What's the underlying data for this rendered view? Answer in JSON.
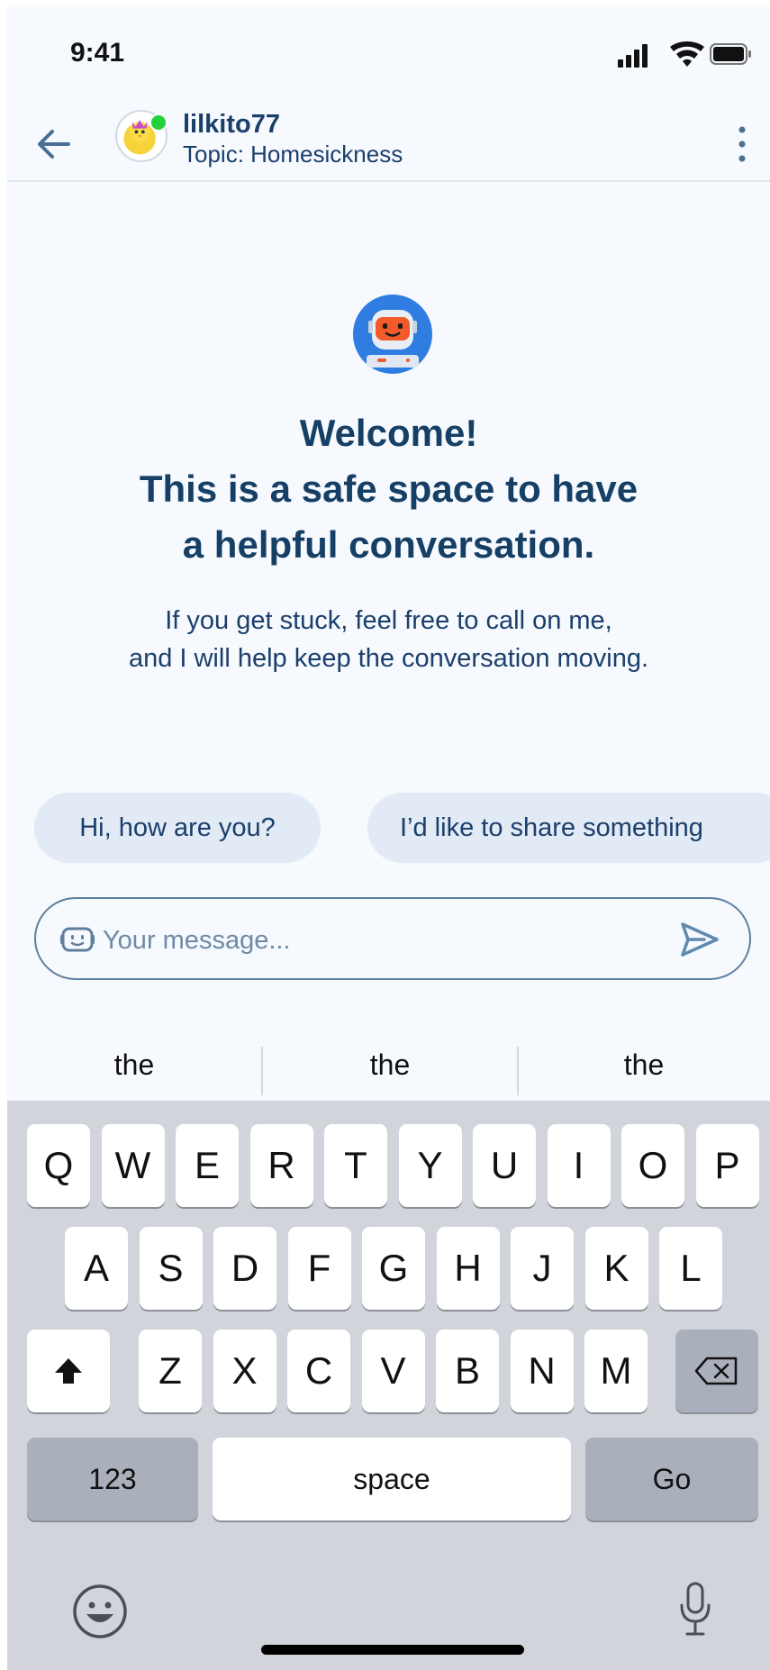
{
  "status_bar": {
    "time": "9:41",
    "icons": [
      "signal-icon",
      "wifi-icon",
      "battery-icon"
    ]
  },
  "header": {
    "username": "lilkito77",
    "topic": "Topic: Homesickness",
    "online": true,
    "icons": [
      "back-arrow-icon",
      "avatar",
      "more-vertical-icon"
    ]
  },
  "welcome": {
    "title": "Welcome!\nThis is a safe space to have\na helpful conversation.",
    "body": "If you get stuck, feel free to call on me,\nand I will help keep the conversation moving."
  },
  "suggestions": [
    {
      "label": "Hi, how are you?"
    },
    {
      "label": "I’d like to share something"
    }
  ],
  "composer": {
    "placeholder": "Your message...",
    "value": ""
  },
  "keyboard": {
    "predictions": [
      "the",
      "the",
      "the"
    ],
    "row1": [
      "Q",
      "W",
      "E",
      "R",
      "T",
      "Y",
      "U",
      "I",
      "O",
      "P"
    ],
    "row2": [
      "A",
      "S",
      "D",
      "F",
      "G",
      "H",
      "J",
      "K",
      "L"
    ],
    "row3": [
      "Z",
      "X",
      "C",
      "V",
      "B",
      "N",
      "M"
    ],
    "numbers_label": "123",
    "space_label": "space",
    "go_label": "Go"
  },
  "colors": {
    "primary_text": "#163f66",
    "chip_bg": "#e1eaf5",
    "online": "#22d23a",
    "bot_blue": "#2f7de1",
    "bot_orange": "#f25a2a"
  }
}
